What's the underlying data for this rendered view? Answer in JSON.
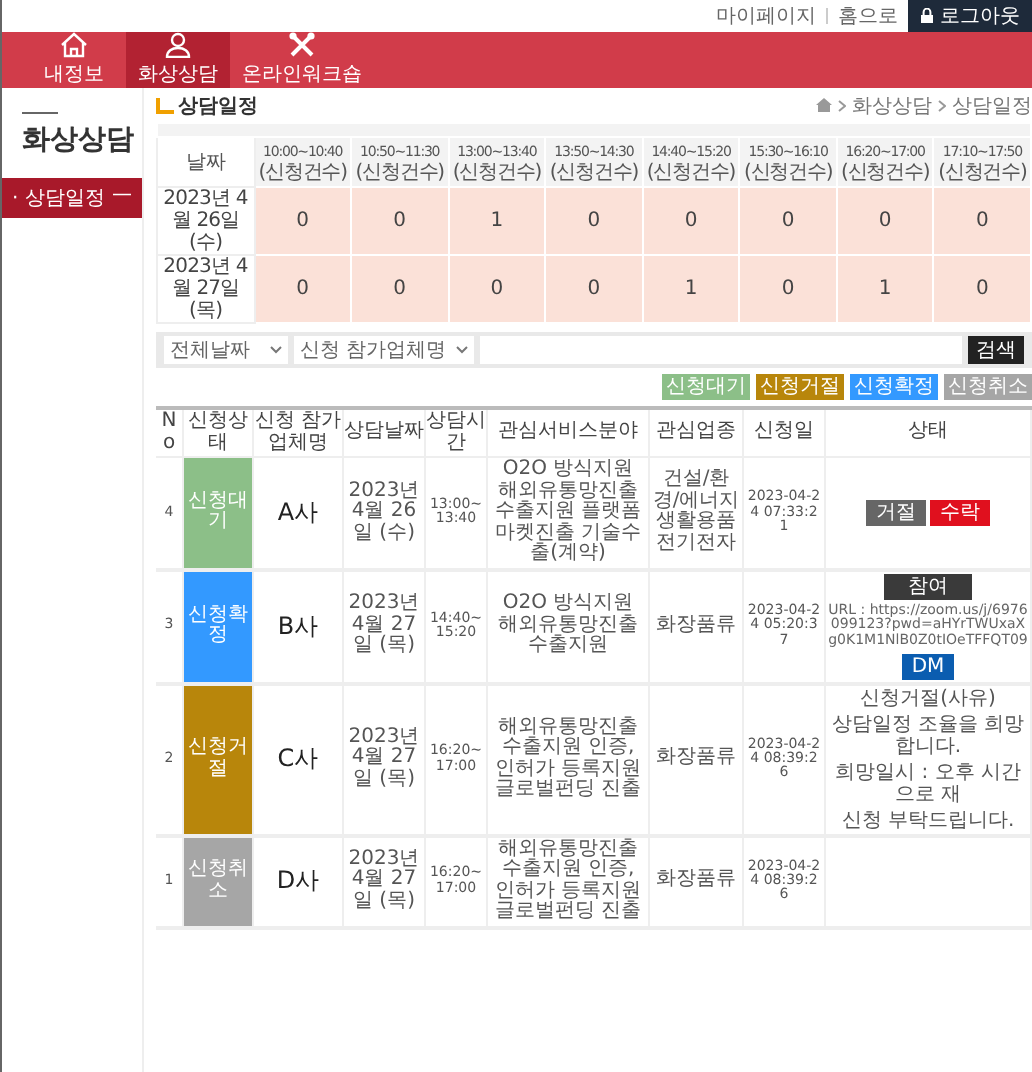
{
  "top_links": [
    "마이페이지",
    "홈으로"
  ],
  "logout": {
    "label": "로그아웃"
  },
  "nav": [
    {
      "label": "내정보",
      "kind": "home",
      "selected": false
    },
    {
      "label": "화상상담",
      "kind": "person",
      "selected": true
    },
    {
      "label": "온라인워크숍",
      "kind": "tools",
      "selected": false
    }
  ],
  "breadcrumb": [
    "화상상담",
    "상담일정"
  ],
  "sidebar": {
    "title": "화상상담",
    "items": [
      {
        "label": "· 상담일정",
        "selected": true,
        "mark": "—"
      }
    ]
  },
  "page_title": "상담일정",
  "schedule": {
    "date_header": "날짜",
    "slots": [
      {
        "time": "10:00~10:40",
        "unit": "(신청건수)"
      },
      {
        "time": "10:50~11:30",
        "unit": "(신청건수)"
      },
      {
        "time": "13:00~13:40",
        "unit": "(신청건수)"
      },
      {
        "time": "13:50~14:30",
        "unit": "(신청건수)"
      },
      {
        "time": "14:40~15:20",
        "unit": "(신청건수)"
      },
      {
        "time": "15:30~16:10",
        "unit": "(신청건수)"
      },
      {
        "time": "16:20~17:00",
        "unit": "(신청건수)"
      },
      {
        "time": "17:10~17:50",
        "unit": "(신청건수)"
      }
    ],
    "rows": [
      {
        "date": "2023년 4월 26일 (수)",
        "counts": [
          "0",
          "0",
          "1",
          "0",
          "0",
          "0",
          "0",
          "0"
        ]
      },
      {
        "date": "2023년 4월 27일 (목)",
        "counts": [
          "0",
          "0",
          "0",
          "0",
          "1",
          "0",
          "1",
          "0"
        ]
      }
    ]
  },
  "filter": {
    "date_select": "전체날짜",
    "field_select": "신청 참가업체명",
    "search_button": "검색"
  },
  "legend": [
    {
      "label": "신청대기",
      "color": "#8cbf88"
    },
    {
      "label": "신청거절",
      "color": "#b8860b"
    },
    {
      "label": "신청확정",
      "color": "#3399ff"
    },
    {
      "label": "신청취소",
      "color": "#a6a6a6"
    }
  ],
  "table": {
    "columns": [
      "No",
      "신청상태",
      "신청 참가업체명",
      "상담날짜",
      "상담시간",
      "관심서비스분야",
      "관심업종",
      "신청일",
      "상태"
    ],
    "rows": [
      {
        "no": "4",
        "status": "신청대기",
        "color": "#8cbf88",
        "company": "A사",
        "date": "2023년 4월 26일 (수)",
        "time": "13:00~13:40",
        "services": "O2O 방식지원 해외유통망진출 수출지원 플랫폼 마켓진출 기술수출(계약)",
        "industry": "건설/환경/에너지 생활용품 전기전자",
        "applied": "2023-04-24 07:33:21",
        "action": {
          "kind": "decide",
          "reject": "거절",
          "accept": "수락"
        }
      },
      {
        "no": "3",
        "status": "신청확정",
        "color": "#3399ff",
        "company": "B사",
        "date": "2023년 4월 27일 (목)",
        "time": "14:40~15:20",
        "services": "O2O 방식지원 해외유통망진출 수출지원",
        "industry": "화장품류",
        "applied": "2023-04-24 05:20:37",
        "action": {
          "kind": "join",
          "join": "참여",
          "url": "URL : https://zoom.us/j/6976099123?pwd=aHYrTWUxaXg0K1M1NlB0Z0tIOeTFFQT09",
          "dm": "DM"
        }
      },
      {
        "no": "2",
        "status": "신청거절",
        "color": "#b8860b",
        "company": "C사",
        "date": "2023년 4월 27일 (목)",
        "time": "16:20~17:00",
        "services": "해외유통망진출 수출지원 인증, 인허가 등록지원 글로벌펀딩 진출",
        "industry": "화장품류",
        "applied": "2023-04-24 08:39:26",
        "action": {
          "kind": "note",
          "lines": [
            "신청거절(사유)",
            "상담일정 조율을 희망합니다.",
            "희망일시 : 오후 시간으로 재",
            "신청 부탁드립니다."
          ]
        }
      },
      {
        "no": "1",
        "status": "신청취소",
        "color": "#a6a6a6",
        "company": "D사",
        "date": "2023년 4월 27일 (목)",
        "time": "16:20~17:00",
        "services": "해외유통망진출 수출지원 인증, 인허가 등록지원 글로벌펀딩 진출",
        "industry": "화장품류",
        "applied": "2023-04-24 08:39:26"
      }
    ]
  }
}
